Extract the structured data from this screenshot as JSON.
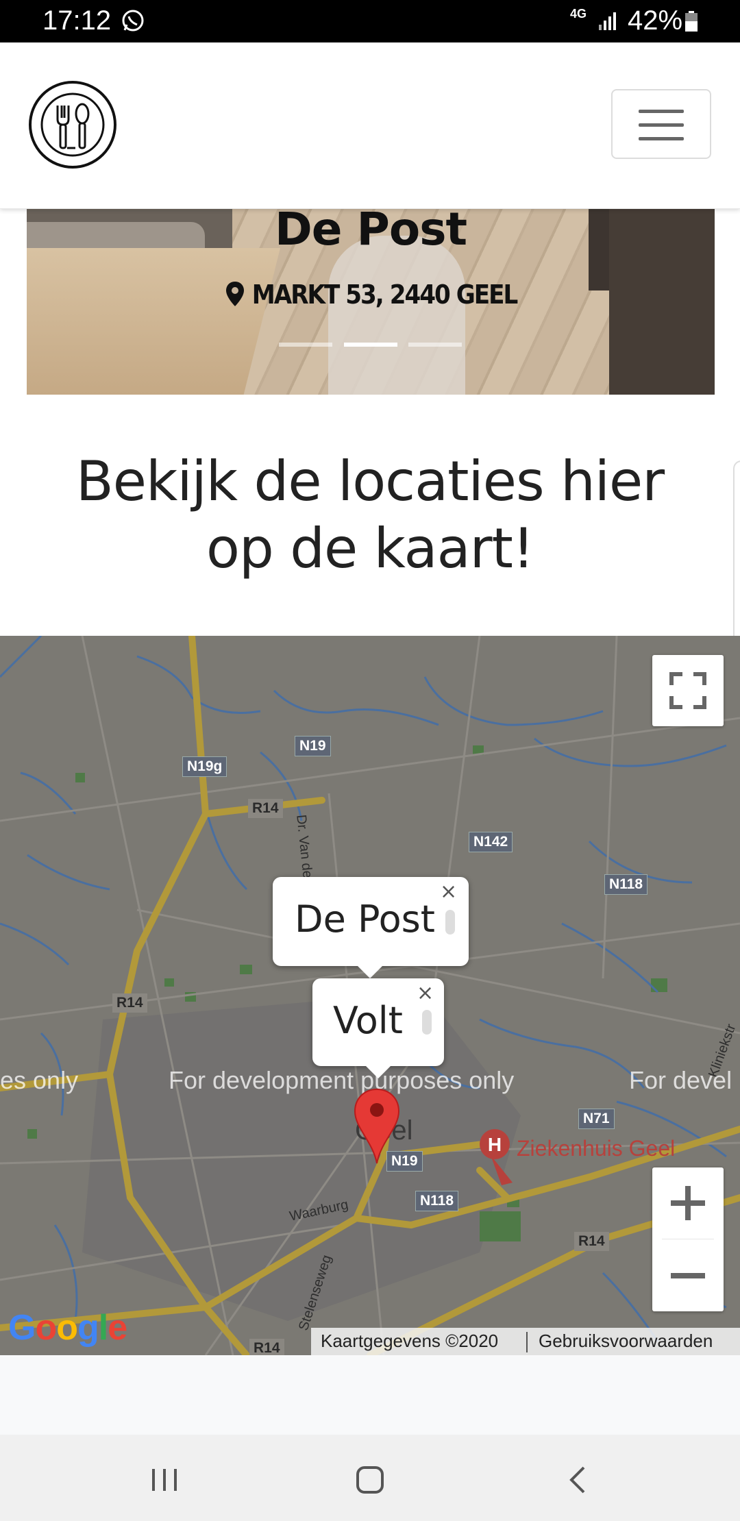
{
  "status_bar": {
    "time": "17:12",
    "network": "4G",
    "battery": "42%",
    "icons": [
      "whatsapp-icon",
      "signal-icon",
      "battery-icon"
    ]
  },
  "header": {
    "logo_icon": "cutlery-logo-icon",
    "menu_icon": "hamburger-menu-icon"
  },
  "hero": {
    "title": "De Post",
    "address": "MARKT 53, 2440 GEEL",
    "carousel_dots": 3,
    "active_dot": 2
  },
  "section": {
    "heading_line1": "Bekijk de locaties hier",
    "heading_line2": "op de kaart!"
  },
  "map": {
    "road_labels": [
      "N19",
      "N19g",
      "R14",
      "N142",
      "N118",
      "R14",
      "N71",
      "N19",
      "N118",
      "R14",
      "R14"
    ],
    "streets": [
      "Dr. Van de",
      "Waarburg",
      "Stelenseweg",
      "Kliniekstr"
    ],
    "dev_watermark": [
      "es only",
      "For development purposes only",
      "For devel"
    ],
    "place_label": "Geel",
    "hospital": "Ziekenhuis Geel",
    "infowindows": [
      {
        "title": "De Post",
        "close": "×"
      },
      {
        "title": "Volt",
        "close": "×"
      }
    ],
    "controls": {
      "fullscreen_icon": "fullscreen-icon",
      "zoom_in": "+",
      "zoom_out": "−"
    },
    "attribution": {
      "data": "Kaartgegevens ©2020",
      "terms": "Gebruiksvoorwaarden"
    },
    "logo": "Google"
  },
  "nav_bar": {
    "icons": [
      "recent-apps-icon",
      "home-icon",
      "back-icon"
    ]
  },
  "colors": {
    "status_bar": "#000000",
    "map_base": "#7c7a74",
    "major_road": "#b49a38",
    "water": "#4a6fa0",
    "marker": "#e53935",
    "road_shield": "#5e6675"
  }
}
